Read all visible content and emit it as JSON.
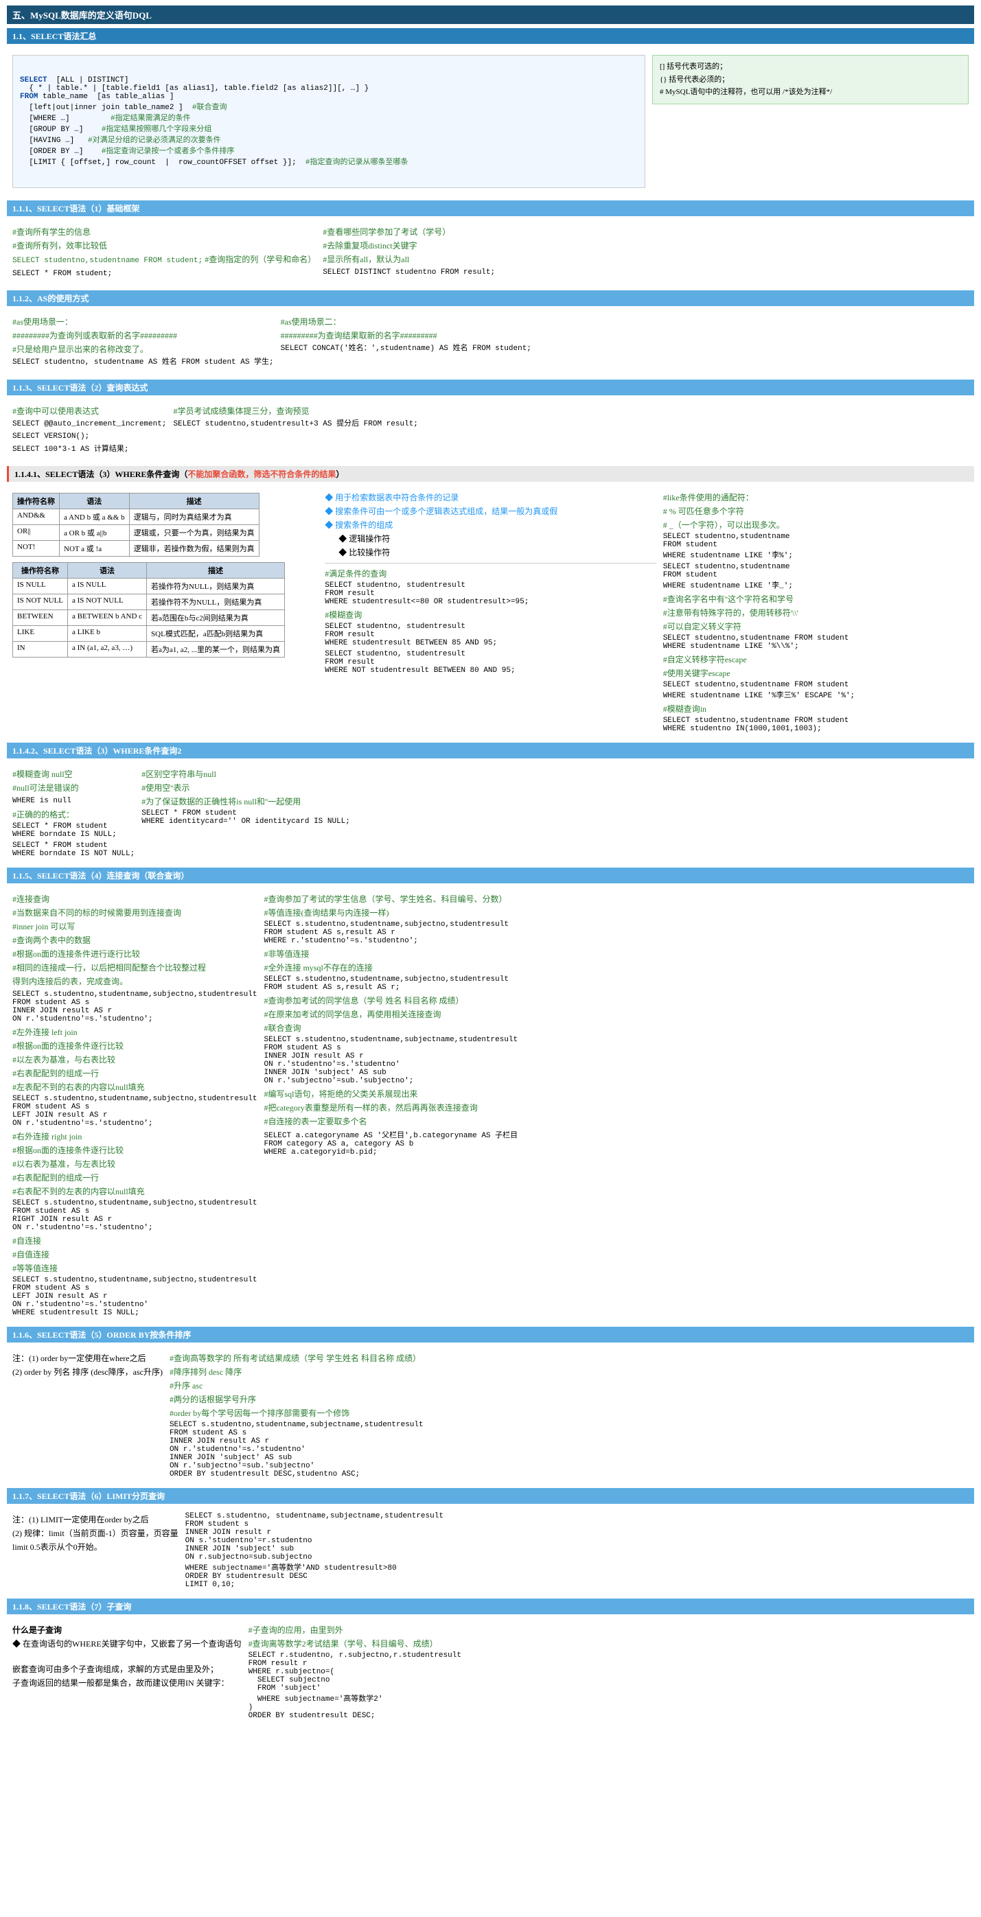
{
  "title": "五、MySQL数据库的定义语句DQL",
  "sections": {
    "s1": {
      "header": "1.1、SELECT语法汇总",
      "code_syntax": "SELECT  [ALL | DISTINCT]\n  { * | table.* | [table.field1 [as alias1], table.field2 [as alias2]][, …] }\nFROM table_name  [as table_alias ]\n  [left|out|inner join table_name2 ]  #联合查询\n  [WHERE …]         #指定结果需满足的条件\n  [GROUP BY …]    #指定结果按照哪几个字段来分组\n  [HAVING …]   #对满足分组的记录必须满足的次要条件\n  [ORDER BY …]    #指定查询记录按一个或者多个条件排序\n  [LIMIT { [offset,] row_count  |  row_countOFFSET offset }];  #指定查询的记录从哪条至哪条",
      "legend": {
        "bracket": "[] 括号代表可选的；",
        "brace": "{} 括号代表必须的；",
        "hash": "#  MySQL语句中的注释符，也可以用 /*该处为注释*/"
      }
    },
    "s1_1": {
      "header": "1.1.1、SELECT语法（1）基础框架",
      "left": {
        "comment1": "#查询所有学生的信息",
        "comment2": "#查询所有列，效率比较低",
        "code1": "SELECT * FROM student;",
        "sub_comment": "#查询指定的列（学号和命名）",
        "code2": "SELECT studentno,studentname FROM student;"
      },
      "right": {
        "comment1": "#查看哪些同学参加了考试（学号）",
        "comment2": "#去除重复项distinct关键字",
        "comment3": "#显示所有all，默认为all",
        "code": "SELECT DISTINCT studentno FROM result;"
      }
    },
    "s1_2": {
      "header": "1.1.2、AS的使用方式",
      "left": {
        "comment1": "#as使用场景一：",
        "comment2": "#########为查询列或表取新的名字#########",
        "comment3": "#只是给用户显示出来的名称改变了。",
        "code": "SELECT studentno, studentname AS 姓名 FROM student AS 学生;"
      },
      "right": {
        "comment1": "#as使用场景二：",
        "comment2": "#########为查询结果取新的名字#########",
        "code": "SELECT CONCAT('姓名：',studentname) AS 姓名 FROM student;"
      }
    },
    "s1_3": {
      "header": "1.1.3、SELECT语法（2）查询表达式",
      "left": {
        "comment": "#查询中可以使用表达式",
        "code1": "SELECT @@auto_increment_increment;",
        "code2": "SELECT VERSION();",
        "code3": "SELECT 100*3-1 AS 计算结果;"
      },
      "right": {
        "comment": "#学员考试成绩集体提三分，查询预览",
        "code": "SELECT studentno,studentresult+3 AS 提分后 FROM result;"
      }
    },
    "s1_4": {
      "header": "1.1.4.1、SELECT语法（3）WHERE条件查询（不能加聚合函数，筛选不符合条件的结果）",
      "operator_table": {
        "headers": [
          "操作符名称",
          "语法",
          "描述"
        ],
        "rows": [
          [
            "AND&&",
            "a AND b 或 a && b",
            "逻辑与，同时为真结果才为真"
          ],
          [
            "OR||",
            "a OR b 或 a||b",
            "逻辑或，只要一个为真，则结果为真"
          ],
          [
            "NOT!",
            "NOT a 或 !a",
            "逻辑非，若操作数为假，结果则为真"
          ]
        ]
      },
      "operator_table2": {
        "headers": [
          "操作符名称",
          "语法",
          "描述"
        ],
        "rows": [
          [
            "IS NULL",
            "a IS NULL",
            "若操作符为NULL，则结果为真"
          ],
          [
            "IS NOT NULL",
            "a IS NOT NULL",
            "若操作符不为NULL，则结果为真"
          ],
          [
            "BETWEEN",
            "a BETWEEN b AND c",
            "若a范围在b与c2间则结果为真"
          ],
          [
            "LIKE",
            "a LIKE b",
            "SQL模式匹配，a匹配b则结果为真"
          ],
          [
            "IN",
            "a IN (a1, a2, a3, …)",
            "若a为a1, a2, ...里的某一个，则结果为真"
          ]
        ]
      },
      "right_content": {
        "bullet1": "用于检索数据表中符合条件的记录",
        "bullet2": "搜索条件可由一个或多个逻辑表达式组成，结果一般为真或假",
        "bullet3": "搜索条件的组成",
        "sub1": "◆ 逻辑操作符",
        "sub2": "◆ 比较操作符",
        "like_comment1": "#like条件使用的通配符：",
        "like_comment2": "#  % 可匹任意多个字符",
        "like_comment3": "#  _（一个字符），可以出现多次。",
        "code_like1": "SELECT studentno,studentname\nFROM student\nWHERE studentname LIKE '李%';",
        "code_like2": "SELECT studentno,studentname\nFROM student\nWHERE studentname LIKE '李_';",
        "comment_escape": "#查询名字名中有''这个字符名和学号\n#注意带有特殊字符的，使用转移符'\\'\n#可以自定义转义字符",
        "code_escape": "SELECT studentno,studentname FROM student\nWHERE studentname LIKE '%\\\\%';"
      },
      "query_sections": {
        "manzu": {
          "comment": "#满足条件的查询",
          "code": "SELECT studentno, studentresult\nFROM result\nWHERE studentresult<=80 OR studentresult>=95;"
        },
        "mohu": {
          "comment": "#模糊查询",
          "code": "SELECT studentno, studentresult\nFROM result\nWHERE studentresult BETWEEN 85 AND 95;"
        },
        "mohu2": {
          "code": "SELECT studentno, studentresult\nFROM result\nWHERE NOT studentresult BETWEEN 80 AND 95;"
        },
        "custom_escape": {
          "comment": "#自定义转移字符escape\n#使用关键字escape",
          "code": "SELECT studentno,studentname FROM student\nWHERE studentname LIKE '%李三%' ESCAPE '%';"
        },
        "in": {
          "comment": "#模糊查询in",
          "code": "SELECT studentno,studentname FROM student\nWHERE studentno IN(1000,1001,1003);"
        }
      }
    },
    "s1_4_2": {
      "header": "1.1.4.2、SELECT语法（3）WHERE条件查询2",
      "left": {
        "comment1": "#模糊查询 null空",
        "comment2": "#null可法是错误的",
        "code1": "WHERE is null",
        "comment3": "#正确的的格式：",
        "code2": "SELECT * FROM student\nWHERE borndate IS NULL;",
        "code3": "SELECT * FROM student\nWHERE borndate IS NOT NULL;"
      },
      "right": {
        "comment1": "#区别空字符串与null",
        "comment2": "#使用空''表示",
        "comment3": "#为了保证数据的正确性将is null和''一起使用",
        "code": "SELECT * FROM student\nWHERE identitycard='' OR identitycard IS NULL;"
      }
    },
    "s1_5": {
      "header": "1.1.5、SELECT语法（4）连接查询（联合查询）",
      "left": {
        "comment1": "#连接查询",
        "comment2": "#当数据来自不同的标的时候需要用到连接查询",
        "inner_join_intro": "#inner join 可以写\n#查询两个表中的数据",
        "note1": "#根据on面的连接条件进行逐行比较",
        "note2": "#相同的连接成一行，以后把相同配整合个比较整过程",
        "note3": "得到内连接后的表，完成查询。",
        "left_join_intro": "#左外连接 left join\n#根据on面的连接条件逐行比较\n#以左表为基准，与右表比较\n#右表配配到的组成一行\n#左表配不到的右表的内容以null填充",
        "right_join_intro": "#右外连接 right join\n#根据on面的连接条件逐行比较\n#以右表为基准，与左表比较\n#右表配配到的组成一行\n#右表配不到的左表的内容以null填充",
        "self_join_intro": "#自连接\n#自连接\n#自值连接\n#等等值连接",
        "code_inner": "SELECT s.studentno,studentname,subjectno,studentresult\nFROM student AS s\nINNER JOIN result AS r\nON r.'studentno'=s.'studentno';",
        "code_inner2": "SELECT s.studentno,studentname,subjectno,studentresult\nFROM student AS s\nLEFT JOIN result AS r\nON r.'studentno'=s.'studentno';",
        "code_right": "SELECT s.studentno,studentname,subjectno,studentresult\nFROM student AS s\nRIGHT JOIN result AS r\nON r.'studentno'=s.'studentno';",
        "code_self": "SELECT s.studentno,studentname,subjectno,studentresult\nFROM student AS s\nLEFT JOIN result AS r\nON r.'studentno'=s.'studentno'\nWHERE studentresult IS NULL;"
      },
      "right": {
        "comment_query": "#查询参加了考试的学生信息（学号、学生姓名、科目编号、分数）",
        "comment_join_order": "#等值连接(查询结果与内连接一样)",
        "code1": "SELECT s.studentno,studentname,subjectno,studentresult\nFROM student AS s,result AS r\nWHERE r.'studentno'=s.'studentno';",
        "comment_non_equal": "#非等值连接",
        "comment_full": "#全外连接 mysql不存在的连接",
        "code_full": "SELECT s.studentno,studentname,subjectno,studentresult\nFROM student AS s,result AS r;",
        "comment_add_info": "#查询参加考试的同学信息（学号 姓名 科目名称 成绩）\n#在原来加考试的同学信息，再使用相关连接查询\n#联合查询",
        "code_add": "SELECT s.studentno,studentname,subjectname,studentresult\nFROM student AS s\nINNER JOIN result AS r\nON r.'studentno'=s.'studentno'\nINNER JOIN 'subject' AS sub\nON r.'subjectno'=sub.'subjectno';",
        "comment_self": "#编写sql语句，将拒绝的父类关系展现出来",
        "comment_self2": "#把category表重整是所有一样的表，然后再再张表连接查询\n#自连接的表一定要取多个名",
        "code_self": "SELECT a.categoryname AS '父栏目',b.categoryname AS 子栏目\nFROM category AS a, category AS b\nWHERE a.categoryid=b.pid;"
      }
    },
    "s1_6": {
      "header": "1.1.6、SELECT语法（5）ORDER BY按条件排序",
      "notes": [
        "(1) order by一定使用在where之后",
        "(2) order by 列名 排序 (desc降序，asc升序)"
      ],
      "right": {
        "comment1": "#查询高等数学的 所有考试结果成绩（学号 学生姓名 科目名称 成绩）",
        "comment2": "#降序排列 desc 降序",
        "comment3": "#升序 asc",
        "comment4": "#两分的话根据学号升序",
        "comment5": "#order by每个学号因每一个排序部需要有一个修饰",
        "code": "SELECT s.studentno,studentname,subjectname,studentresult\nFROM student AS s\nINNER JOIN result AS r\nON r.'studentno'=s.'studentno'\nINNER JOIN 'subject' AS sub\nON r.'subjectno'=sub.'subjectno'\nORDER BY studentresult DESC,studentno ASC;"
      }
    },
    "s1_7": {
      "header": "1.1.7、SELECT语法（6）LIMIT分页查询",
      "notes": [
        "(1) LIMIT一定使用在order by之后",
        "(2) 规律：limit（当前页面-1）页容量，页容量",
        "limit 0.5表示从个0开始。"
      ],
      "right": {
        "code": "SELECT s.studentno, studentname,subjectname,studentresult\nFROM student s\nINNER JOIN result r\nON s.'studentno'=r.studentno\nINNER JOIN 'subject' sub\nON r.subjectno=sub.subjectno\nWHERE subjectname='高等数学'AND studentresult>80\nORDER BY studentresult DESC\nLIMIT 0,10;"
      }
    },
    "s1_8": {
      "header": "1.1.8、SELECT语法（7）子查询",
      "what": {
        "title": "什么是子查询",
        "desc1": "◆ 在查询语句的WHERE关键字句中，又嵌套了另一个查询语句"
      },
      "nested_desc": "嵌套查询可由多个子查询组成，求解的方式是由里及外；\n子查询返回的结果一般都是集合，故而建议使用IN 关键字：",
      "right": {
        "comment1": "#子查询的应用，由里到外",
        "comment2": "#查询离等数学2考试结果（学号、科目编号、成绩）",
        "code": "SELECT r.studentno, r.subjectno,r.studentresult\nFROM result r\nWHERE r.subjectno=(\n  SELECT subjectno\n  FROM 'subject'\n  WHERE subjectname='高等数学2'\n)\nORDER BY studentresult DESC;"
      }
    }
  }
}
